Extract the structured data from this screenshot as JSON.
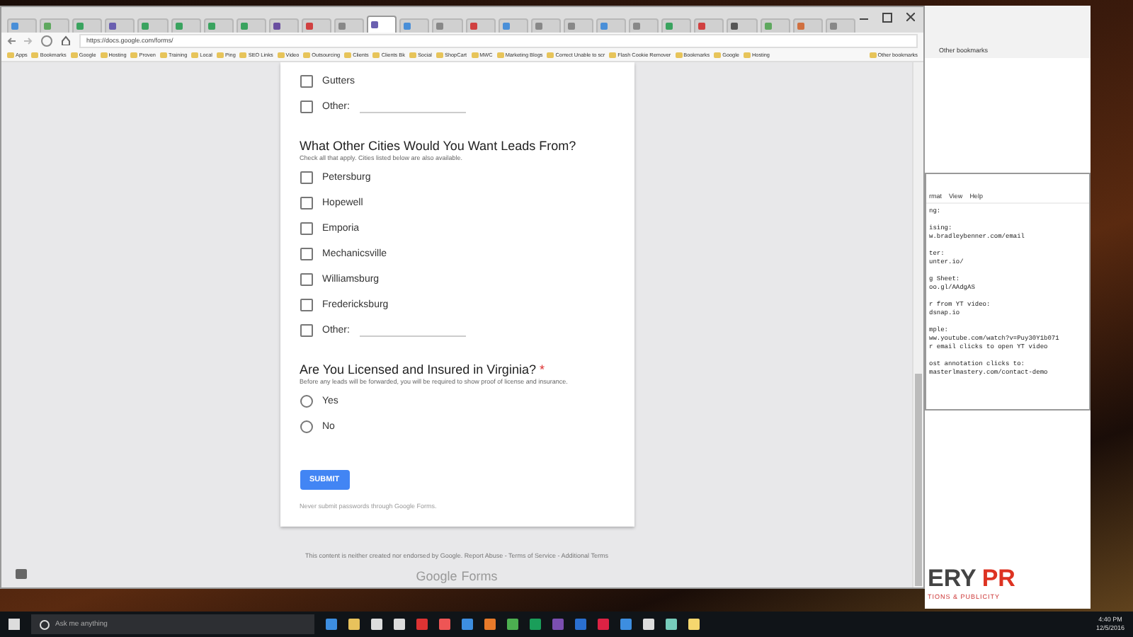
{
  "browser": {
    "tabs": [
      {
        "color": "#4a8fd8",
        "selected": false
      },
      {
        "color": "#5fa85f",
        "selected": false
      },
      {
        "color": "#3aa35f",
        "selected": false
      },
      {
        "color": "#6a5fb0",
        "selected": false
      },
      {
        "color": "#3aa35f",
        "selected": false
      },
      {
        "color": "#3aa35f",
        "selected": false
      },
      {
        "color": "#3aa35f",
        "selected": false
      },
      {
        "color": "#3aa35f",
        "selected": false
      },
      {
        "color": "#6a4fa0",
        "selected": false
      },
      {
        "color": "#d04040",
        "selected": false
      },
      {
        "color": "#888888",
        "selected": false
      },
      {
        "color": "#6a5fb0",
        "selected": true
      },
      {
        "color": "#4a8fd8",
        "selected": false
      },
      {
        "color": "#888888",
        "selected": false
      },
      {
        "color": "#d04040",
        "selected": false
      },
      {
        "color": "#4a8fd8",
        "selected": false
      },
      {
        "color": "#888888",
        "selected": false
      },
      {
        "color": "#888888",
        "selected": false
      },
      {
        "color": "#4a8fd8",
        "selected": false
      },
      {
        "color": "#888888",
        "selected": false
      },
      {
        "color": "#3aa35f",
        "selected": false
      },
      {
        "color": "#d04040",
        "selected": false
      },
      {
        "color": "#555555",
        "selected": false
      },
      {
        "color": "#5fa85f",
        "selected": false
      },
      {
        "color": "#d07040",
        "selected": false
      },
      {
        "color": "#888888",
        "selected": false
      }
    ],
    "address": "https://docs.google.com/forms/",
    "bookmarks": [
      "Apps",
      "Bookmarks",
      "Google",
      "Hosting",
      "Proven",
      "Training",
      "Local",
      "Ping",
      "SEO Links",
      "Video",
      "Outsourcing",
      "Clients",
      "Clients Bk",
      "Social",
      "ShopCart",
      "MWC",
      "Marketing Blogs",
      "Correct Unable to scr",
      "Flash Cookie Remover",
      "Bookmarks",
      "Google",
      "Hosting",
      "Other bookmarks"
    ]
  },
  "form": {
    "items_top": [
      {
        "label": "Gutters",
        "kind": "checkbox",
        "checked": false
      },
      {
        "label": "Other:",
        "kind": "other",
        "checked": false
      }
    ],
    "questions": [
      {
        "title": "What Other Cities Would You Want Leads From?",
        "help": "Check all that apply. Cities listed below are also available.",
        "options": [
          {
            "label": "Petersburg",
            "kind": "checkbox",
            "checked": false
          },
          {
            "label": "Hopewell",
            "kind": "checkbox",
            "checked": false
          },
          {
            "label": "Emporia",
            "kind": "checkbox",
            "checked": false
          },
          {
            "label": "Mechanicsville",
            "kind": "checkbox",
            "checked": false
          },
          {
            "label": "Williamsburg",
            "kind": "checkbox",
            "checked": false
          },
          {
            "label": "Fredericksburg",
            "kind": "checkbox",
            "checked": false
          },
          {
            "label": "Other:",
            "kind": "other",
            "checked": false
          }
        ]
      },
      {
        "title": "Are You Licensed and Insured in Virginia?",
        "required_mark": "*",
        "help": "Before any leads will be forwarded, you will be required to show proof of license and insurance.",
        "options": [
          {
            "label": "Yes",
            "kind": "radio",
            "selected": false
          },
          {
            "label": "No",
            "kind": "radio",
            "selected": false
          }
        ]
      }
    ],
    "submit": "SUBMIT",
    "note": "Never submit passwords through Google Forms.",
    "footer": "This content is neither created nor endorsed by Google. Report Abuse - Terms of Service - Additional Terms",
    "brand": "Google",
    "brand_suffix": "Forms"
  },
  "notepad": {
    "menu": [
      "rmat",
      "View",
      "Help"
    ],
    "blocks": [
      [
        "ng:"
      ],
      [
        "ising:",
        "w.bradleybenner.com/email"
      ],
      [
        "ter:",
        "unter.io/"
      ],
      [
        "g Sheet:",
        "oo.gl/AAdgAS"
      ],
      [
        "r from YT video:",
        "dsnap.io"
      ],
      [
        "mple:",
        "ww.youtube.com/watch?v=Puy30Y1b071",
        "r email clicks to open YT video"
      ],
      [
        "ost annotation clicks to:",
        "masterlmastery.com/contact-demo"
      ]
    ]
  },
  "back_window": {
    "bookmark": "Other bookmarks",
    "logo_dark": "ERY",
    "logo_red": "PR",
    "tagline": "TIONS & PUBLICITY"
  },
  "taskbar": {
    "search_placeholder": "Ask me anything",
    "time": "4:40 PM",
    "date": "12/5/2016"
  }
}
